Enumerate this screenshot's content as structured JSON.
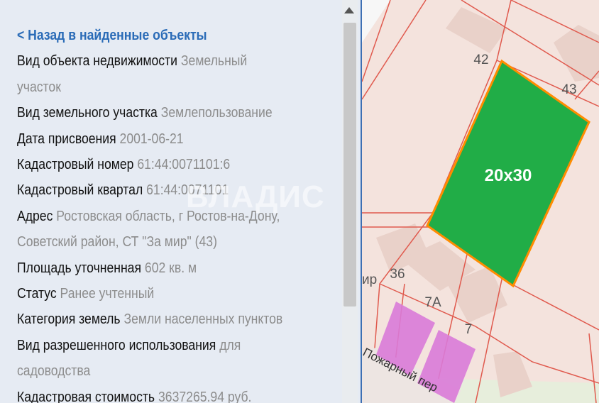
{
  "panel": {
    "back_link": "< Назад в найденные объекты",
    "fields": [
      {
        "label": "Вид объекта недвижимости",
        "value": "Земельный"
      },
      {
        "label": "",
        "value": "участок"
      },
      {
        "label": "Вид земельного участка",
        "value": "Землепользование"
      },
      {
        "label": "Дата присвоения",
        "value": "2001-06-21"
      },
      {
        "label": "Кадастровый номер",
        "value": "61:44:0071101:6"
      },
      {
        "label": "Кадастровый квартал",
        "value": "61:44:0071101"
      },
      {
        "label": "Адрес",
        "value": "Ростовская область, г Ростов-на-Дону,"
      },
      {
        "label": "",
        "value": "Советский район, СТ \"За мир\" (43)"
      },
      {
        "label": "Площадь уточненная",
        "value": "602 кв. м"
      },
      {
        "label": "Статус",
        "value": "Ранее учтенный"
      },
      {
        "label": "Категория земель",
        "value": "Земли населенных пунктов"
      },
      {
        "label": "Вид разрешенного использования",
        "value": "для"
      },
      {
        "label": "",
        "value": "садоводства"
      },
      {
        "label": "Кадастровая стоимость",
        "value": "3637265.94 руб."
      }
    ]
  },
  "map": {
    "labels": {
      "n42": "42",
      "n43": "43",
      "n36": "36",
      "n7a": "7А",
      "n7": "7",
      "mir": "ир"
    },
    "parcel_label": "20x30",
    "street": "Пожарный пер",
    "colors": {
      "parcel_fill": "#21ad47",
      "parcel_border": "#ff8c00",
      "pink": "#d97ad8",
      "lines": "#e05a4e"
    }
  },
  "watermark": "ВЛАДИС"
}
